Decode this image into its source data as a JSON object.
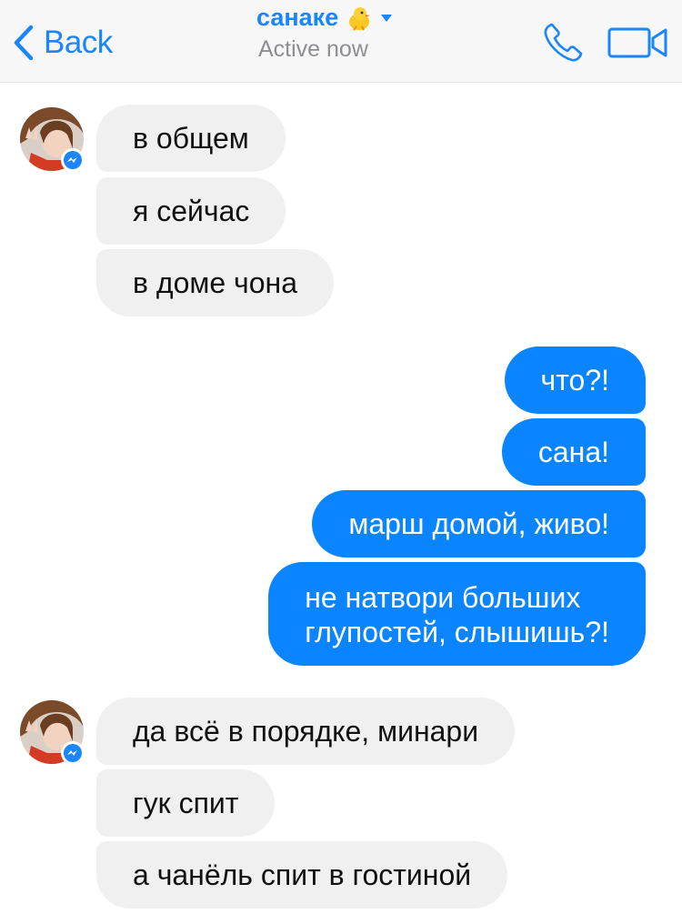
{
  "header": {
    "back_label": "Back",
    "contact_name": "санаке",
    "status": "Active now",
    "accent_color": "#1a86f9",
    "icons": [
      "chevron-left-icon",
      "chick-emoji-icon",
      "caret-down-icon",
      "phone-icon",
      "video-camera-icon"
    ]
  },
  "messages": {
    "group1": [
      "в общем",
      "я сейчас",
      "в доме чона"
    ],
    "group2": [
      "что?!",
      "сана!",
      "марш домой, живо!",
      "не натвори больших\nглупостей, слышишь?!"
    ],
    "group3": [
      "да всё в порядке, минари",
      "гук спит",
      "а чанёль спит в гостиной"
    ]
  },
  "colors": {
    "incoming_bubble": "#f1f0f0",
    "outgoing_bubble": "#0a84ff",
    "header_bg": "#f7f7f7"
  }
}
